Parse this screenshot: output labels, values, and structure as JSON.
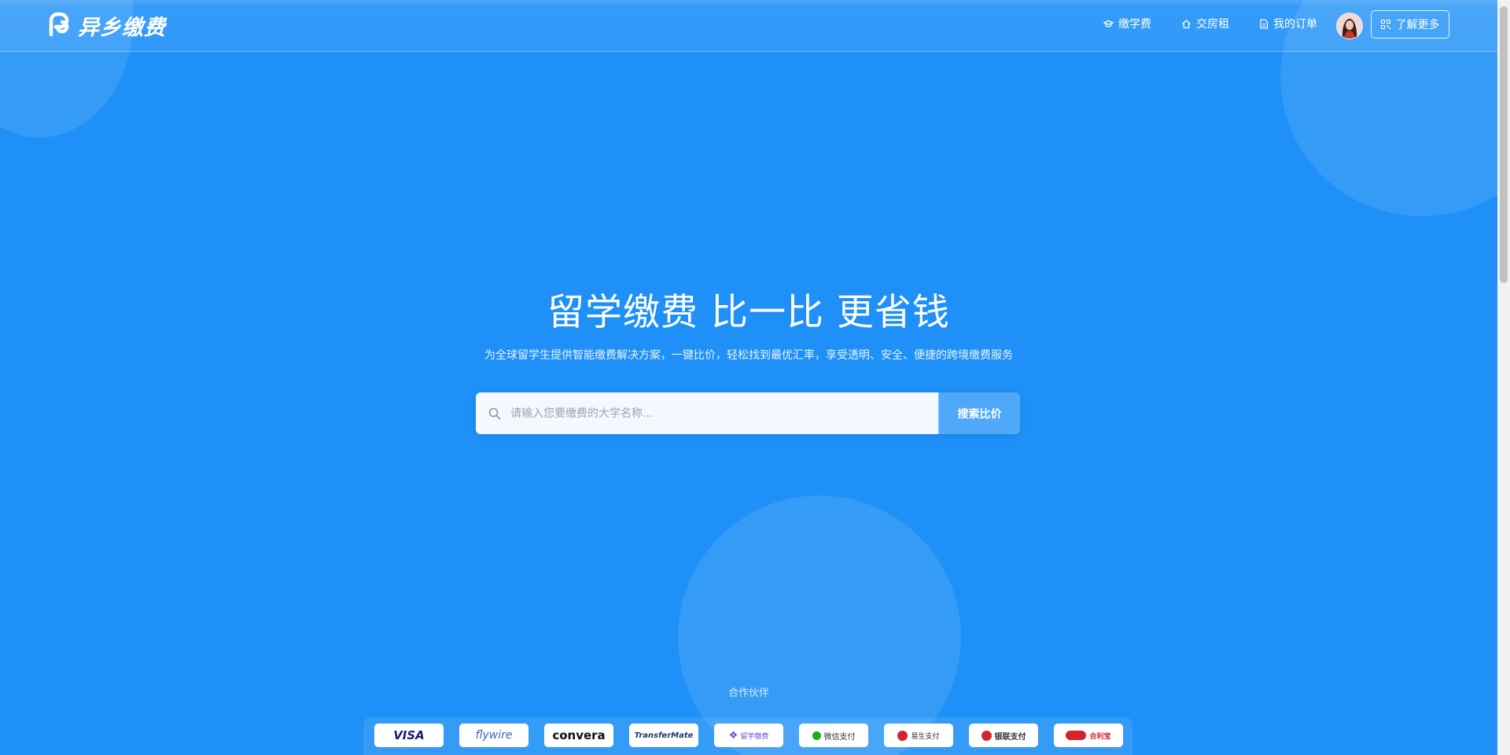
{
  "brand": {
    "logo_text": "异乡缴费"
  },
  "nav": {
    "items": [
      {
        "label": "缴学费",
        "icon": "graduation-cap-icon"
      },
      {
        "label": "交房租",
        "icon": "home-icon"
      },
      {
        "label": "我的订单",
        "icon": "document-icon"
      }
    ],
    "learn_more": "了解更多"
  },
  "hero": {
    "title": "留学缴费 比一比 更省钱",
    "subtitle": "为全球留学生提供智能缴费解决方案，一键比价，轻松找到最优汇率，享受透明、安全、便捷的跨境缴费服务"
  },
  "search": {
    "placeholder": "请输入您要缴费的大学名称...",
    "button": "搜索比价"
  },
  "partners": {
    "label": "合作伙伴",
    "items": [
      {
        "name": "VISA",
        "color": "#1a1f71"
      },
      {
        "name": "flywire",
        "color": "#3b63c8"
      },
      {
        "name": "convera",
        "color": "#111111"
      },
      {
        "name": "TransferMate",
        "color": "#1f3a6e"
      },
      {
        "name": "留学缴费",
        "color": "#6b4dd8"
      },
      {
        "name": "微信支付",
        "color": "#1aad19"
      },
      {
        "name": "易生支付",
        "color": "#d4232b"
      },
      {
        "name": "银联支付",
        "color": "#d4232b"
      },
      {
        "name": "合利宝",
        "color": "#d4232b"
      }
    ]
  },
  "colors": {
    "background": "#1e90f7",
    "search_field": "#f5f9ff"
  }
}
